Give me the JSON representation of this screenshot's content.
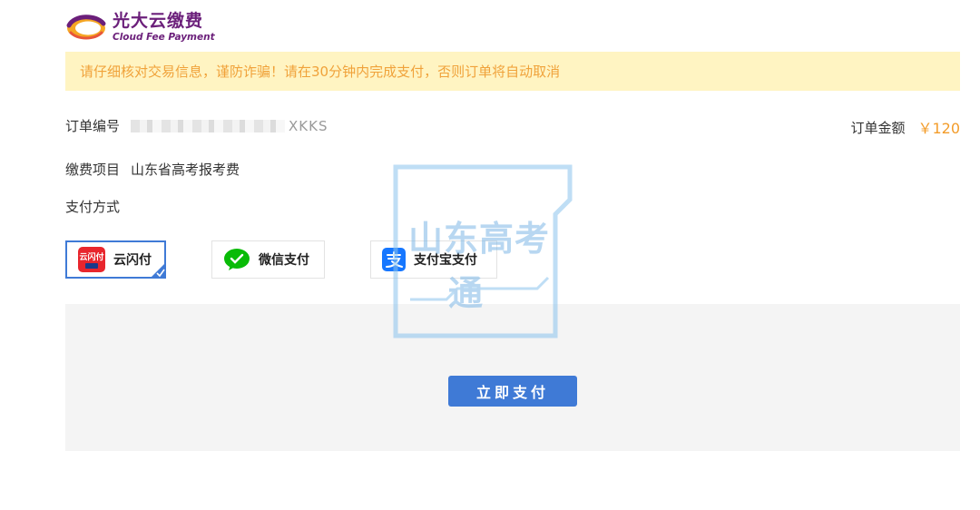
{
  "brand": {
    "name_cn": "光大云缴费",
    "name_en": "Cloud Fee Payment",
    "colors": {
      "logo": "#6b1f7a",
      "logo_accent": "#f5a623"
    }
  },
  "notice": {
    "text": "请仔细核对交易信息，谨防诈骗！请在30分钟内完成支付，否则订单将自动取消",
    "colors": {
      "background": "#fff4c2",
      "text": "#f0a23a"
    }
  },
  "order": {
    "number_label": "订单编号",
    "number_value": "XKKS",
    "amount_label": "订单金额",
    "amount_value": "￥120",
    "item_label": "缴费项目",
    "item_value": "山东省高考报考费",
    "method_label": "支付方式"
  },
  "payment_methods": [
    {
      "label": "云闪付",
      "icon": "unionpay-icon",
      "icon_text": "云闪付",
      "selected": true
    },
    {
      "label": "微信支付",
      "icon": "wechat-pay-icon",
      "selected": false
    },
    {
      "label": "支付宝支付",
      "icon": "alipay-icon",
      "selected": false
    }
  ],
  "pay_button": {
    "label": "立即支付",
    "color": "#3f7ad6"
  },
  "watermark": {
    "line1": "山东高考",
    "line2": "通"
  }
}
